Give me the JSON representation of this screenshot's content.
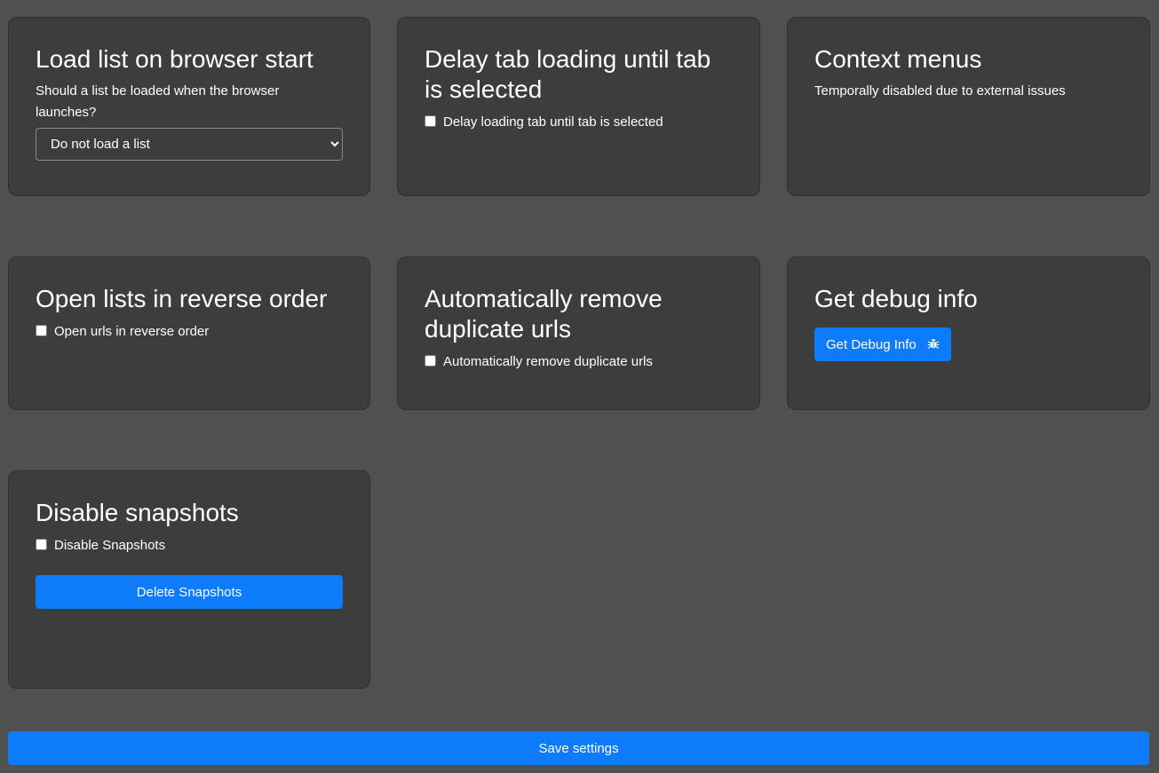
{
  "cards": {
    "load_list": {
      "title": "Load list on browser start",
      "description": "Should a list be loaded when the browser launches?",
      "select_value": "Do not load a list",
      "options": [
        "Do not load a list"
      ]
    },
    "delay_tab": {
      "title": "Delay tab loading until tab is selected",
      "checkbox_label": "Delay loading tab until tab is selected",
      "checked": false
    },
    "context_menus": {
      "title": "Context menus",
      "description": "Temporally disabled due to external issues"
    },
    "reverse_order": {
      "title": "Open lists in reverse order",
      "checkbox_label": "Open urls in reverse order",
      "checked": false
    },
    "remove_duplicates": {
      "title": "Automatically remove duplicate urls",
      "checkbox_label": "Automatically remove duplicate urls",
      "checked": false
    },
    "debug_info": {
      "title": "Get debug info",
      "button_label": "Get Debug Info",
      "button_icon": "bug-icon"
    },
    "snapshots": {
      "title": "Disable snapshots",
      "checkbox_label": "Disable Snapshots",
      "checked": false,
      "delete_button_label": "Delete Snapshots"
    }
  },
  "footer": {
    "save_label": "Save settings"
  },
  "colors": {
    "background": "#505050",
    "card": "#3d3d3d",
    "accent": "#0d7bfa",
    "text": "#ffffff"
  }
}
